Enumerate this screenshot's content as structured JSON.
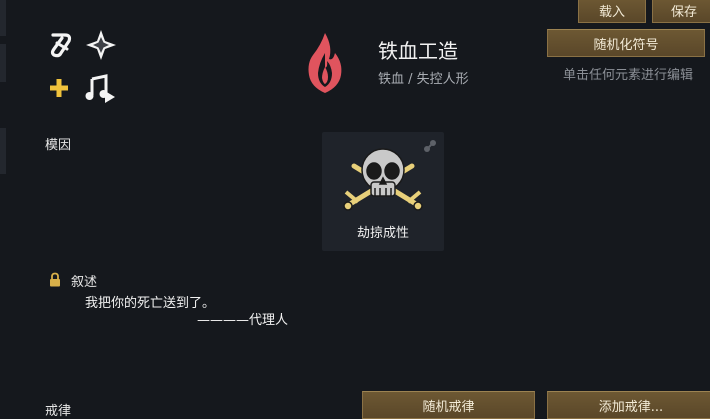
{
  "toolbar": {
    "load_label": "载入",
    "save_label": "保存",
    "randomize_symbol_label": "随机化符号",
    "edit_hint": "单击任何元素进行编辑"
  },
  "ideology": {
    "name": "铁血工造",
    "subtitle": "铁血 / 失控人形",
    "icon": "fire-flame-icon",
    "icon_color": "#e0545e"
  },
  "memes": {
    "section_label": "模因",
    "items": [
      {
        "name": "劫掠成性",
        "icon": "skull-crossed-swords-icon"
      }
    ]
  },
  "narrative": {
    "section_label": "叙述",
    "quote": "我把你的死亡送到了。",
    "attribution": "————代理人"
  },
  "precepts": {
    "section_label": "戒律",
    "random_label": "随机戒律",
    "add_label": "添加戒律..."
  },
  "colors": {
    "accent_gold": "#f0c23c",
    "button_bg": "#6d5833"
  }
}
